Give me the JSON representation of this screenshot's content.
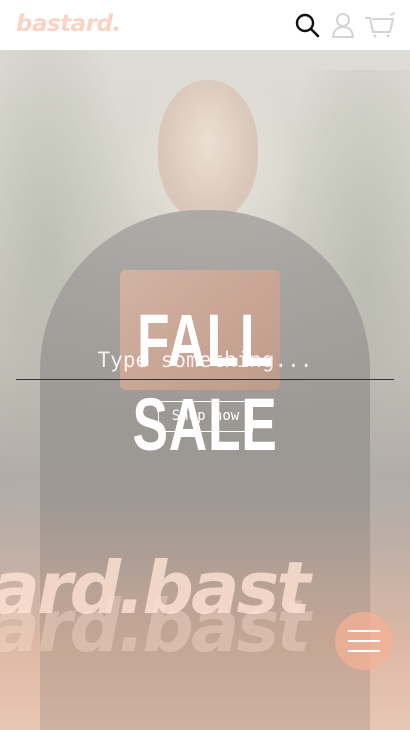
{
  "header": {
    "logo_text": "bastard.",
    "icons": [
      "search-icon",
      "user-icon",
      "cart-icon"
    ]
  },
  "hero": {
    "title": "FALL SALE",
    "search_placeholder": "Type something...",
    "shop_button_label": "Shop now",
    "watermark_text": "tard.bast",
    "menu_icon": "hamburger-icon"
  },
  "colors": {
    "brand": "#f7d4c4",
    "menu_fab": "#f4b296",
    "text_on_hero": "#ffffff"
  }
}
